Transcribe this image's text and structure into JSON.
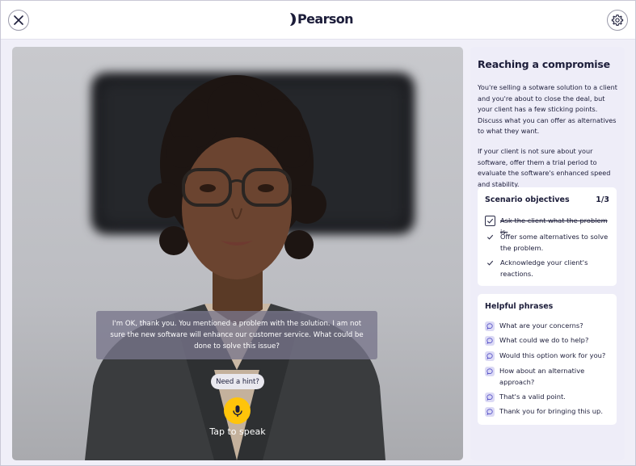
{
  "header": {
    "logo_text": "Pearson",
    "close_icon": "close-icon",
    "settings_icon": "gear-icon"
  },
  "video": {
    "caption": "I'm OK, thank you. You mentioned a problem with the solution. I am not sure the new software will enhance our customer service. What could be done to solve this issue?",
    "hint_label": "Need a hint?",
    "mic_icon": "microphone-icon",
    "tap_label": "Tap to speak"
  },
  "panel": {
    "title": "Reaching a compromise",
    "paragraph1": "You're selling a sotware solution to a client and you're about to close the deal, but your client has a few sticking points. Discuss what you can offer as alternatives to what they want.",
    "paragraph2": "If your client is not sure about your software, offer them a trial period to evaluate the software's enhanced speed and stability.",
    "objectives": {
      "title": "Scenario objectives",
      "count": "1/3",
      "items": [
        {
          "label": "Ask the client what the problem is.",
          "done": true
        },
        {
          "label": "Offer some alternatives to solve the problem.",
          "done": false
        },
        {
          "label": "Acknowledge your client's reactions.",
          "done": false
        }
      ]
    },
    "phrases": {
      "title": "Helpful phrases",
      "items": [
        "What are your concerns?",
        "What could we do to help?",
        "Would this option work for you?",
        "How about an alternative approach?",
        "That's a valid point.",
        "Thank you for bringing this up."
      ]
    }
  },
  "colors": {
    "accent": "#ffc40a",
    "panel_bg": "#eeedf8",
    "text": "#1c1d3a",
    "phrase_icon_bg": "#dcdaf5"
  }
}
